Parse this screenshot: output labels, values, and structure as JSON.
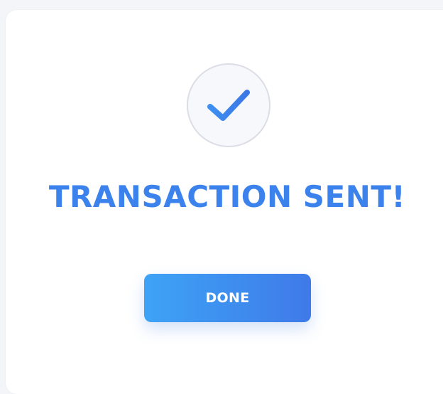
{
  "dialog": {
    "icon": "checkmark-icon",
    "title": "TRANSACTION SENT!",
    "done_label": "DONE"
  },
  "colors": {
    "accent": "#3b82ec",
    "button_gradient_start": "#3ea3f6",
    "button_gradient_end": "#3f7ae8",
    "background": "#f4f5f9",
    "card": "#ffffff"
  }
}
